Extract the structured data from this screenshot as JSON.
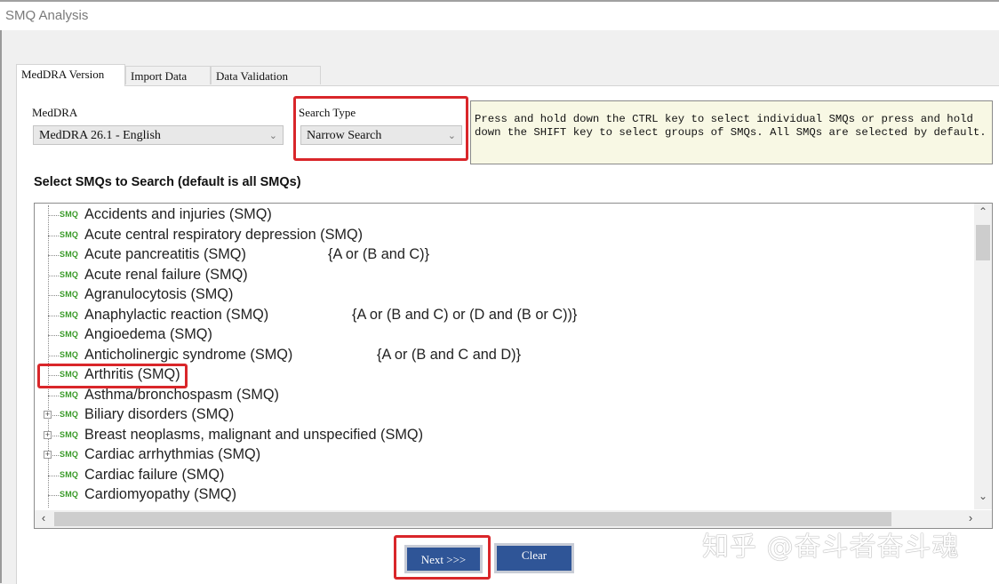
{
  "window": {
    "title": "SMQ Analysis"
  },
  "tabs": [
    {
      "label": "MedDRA Version",
      "active": true
    },
    {
      "label": "Import Data",
      "active": false
    },
    {
      "label": "Data Validation",
      "active": false
    }
  ],
  "meddra": {
    "label": "MedDRA",
    "value": "MedDRA 26.1 - English"
  },
  "search_type": {
    "label": "Search Type",
    "value": "Narrow Search"
  },
  "hint": "Press and hold down the CTRL key to select individual SMQs or press and hold down the SHIFT key to select groups of SMQs.  All SMQs are selected by default.",
  "section_title": "Select SMQs to Search (default is all SMQs)",
  "smq_badge": "SMQ",
  "tree_items": [
    {
      "name": "Accidents and injuries (SMQ)",
      "formula": "",
      "expandable": false
    },
    {
      "name": "Acute central respiratory depression (SMQ)",
      "formula": "",
      "expandable": false
    },
    {
      "name": "Acute pancreatitis (SMQ)",
      "formula": "{A or (B and C)}",
      "expandable": false
    },
    {
      "name": "Acute renal failure (SMQ)",
      "formula": "",
      "expandable": false
    },
    {
      "name": "Agranulocytosis (SMQ)",
      "formula": "",
      "expandable": false
    },
    {
      "name": "Anaphylactic reaction (SMQ)",
      "formula": "{A or (B and C) or (D and (B or C))}",
      "expandable": false
    },
    {
      "name": "Angioedema (SMQ)",
      "formula": "",
      "expandable": false
    },
    {
      "name": "Anticholinergic syndrome (SMQ)",
      "formula": "{A or (B and C and D)}",
      "expandable": false
    },
    {
      "name": "Arthritis (SMQ)",
      "formula": "",
      "expandable": false,
      "highlighted": true
    },
    {
      "name": "Asthma/bronchospasm (SMQ)",
      "formula": "",
      "expandable": false
    },
    {
      "name": "Biliary disorders (SMQ)",
      "formula": "",
      "expandable": true
    },
    {
      "name": "Breast neoplasms, malignant and unspecified (SMQ)",
      "formula": "",
      "expandable": true
    },
    {
      "name": "Cardiac arrhythmias (SMQ)",
      "formula": "",
      "expandable": true
    },
    {
      "name": "Cardiac failure (SMQ)",
      "formula": "",
      "expandable": false
    },
    {
      "name": "Cardiomyopathy (SMQ)",
      "formula": "",
      "expandable": false
    }
  ],
  "buttons": {
    "next": "Next >>>",
    "clear": "Clear"
  },
  "watermark": "知乎 @奋斗者奋斗魂",
  "colors": {
    "highlight_red": "#d9262a",
    "button_blue": "#2f5597",
    "smq_green": "#3b9b2a",
    "hint_bg": "#f8f8e4"
  }
}
